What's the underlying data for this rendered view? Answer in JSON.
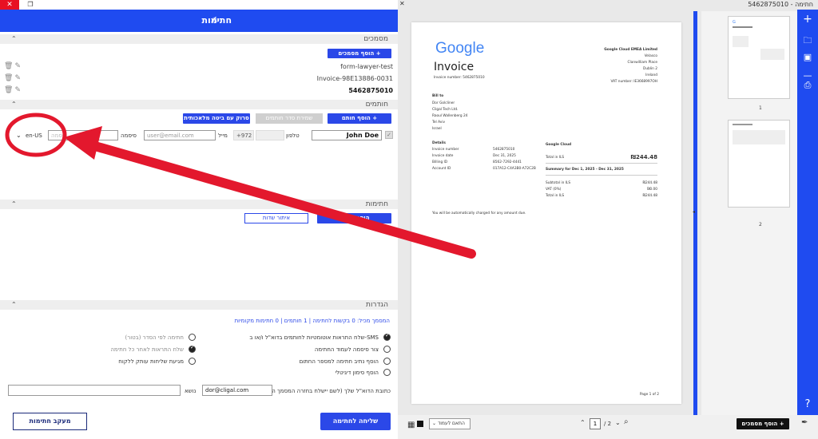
{
  "left_panel": {
    "window_close": "✕",
    "window_restore": "❐",
    "header_title": "חתימות",
    "docs_section": "מסמכים",
    "add_docs_btn": "הוסף מסמכים +",
    "documents": [
      "form-lawyer-test",
      "Invoice-98E13886-0031",
      "5462875010"
    ],
    "signers_section": "חותמים",
    "add_signer_btn": "הוסף חותם +",
    "signer_order_btn": "שמירת סדר חותמים",
    "send_sign_btn": "סרוק עם ביטה מלאכותית",
    "signer_name": "John Doe",
    "phone_label": "טלפון",
    "phone_code": "+972",
    "email_label": "מייל",
    "email_placeholder": "user@email.com",
    "password_label": "סיסמה",
    "password_placeholder": "סיסמה",
    "lang_value": "en-US",
    "signatures_section": "חתימות",
    "add_signature_btn": "הוספת שדה",
    "locate_fields_btn": "איתור שדות",
    "settings_section": "הגדרות",
    "summary_text": "המסמך מכיל: 0 בקשות לחתימה | 1 חותמים | 0 חתימות מקומיות",
    "options_right": [
      "שלח התראות אוטומטיות לחותמים בדוא\"ל ו/או ב-SMS",
      "צור סיסמה לעמוד החתימה",
      "הוסף נתיב חתימה למספר החתום",
      "הוסף סימון דיגיטלי"
    ],
    "options_left": [
      "חתימה לפי הסדר (בטור)",
      "שלח התראות לאחר כל חתימה",
      "מגיעת שליחות עותק ללקוח"
    ],
    "email_field_label": "כתובת הדוא\"ל שלך (לשם יישלח בחזרה המסמך החתום)",
    "email_value": "dor@cligal.com",
    "subject_label": "נושא",
    "send_for_sign_btn": "שליחה לחתימה",
    "track_sign_btn": "מעקב חתימות"
  },
  "right_panel": {
    "title": "5462875010 - חתימה",
    "invoice": {
      "logo": "Google",
      "title": "Invoice",
      "invoice_number_line": "Invoice number: 5462875010",
      "company": [
        "Google Cloud EMEA Limited",
        "Velasco",
        "Clanwilliam Place",
        "Dublin 2",
        "Ireland",
        "VAT number: IE3668997OH"
      ],
      "bill_to_label": "Bill to",
      "bill_to": [
        "Dor Golcliner",
        "Cligal Tech Ltd.",
        "Raoul Wallenberg 24",
        "Tel Aviv",
        "Israel"
      ],
      "details_label": "Details",
      "details": [
        {
          "k": "Invoice number",
          "v": "5462875010"
        },
        {
          "k": "Invoice date",
          "v": "Dec 31, 2025"
        },
        {
          "k": "Billing ID",
          "v": "8562-7292-4441"
        },
        {
          "k": "Account ID",
          "v": "017A12-C4A3B0-A72C2B"
        }
      ],
      "gc_label": "Google Cloud",
      "total_label": "Total in ILS",
      "total_value": "₪244.48",
      "summary_label": "Summary for Dec 1, 2025 - Dec 31, 2025",
      "summary": [
        {
          "k": "Subtotal in ILS",
          "v": "₪244.48"
        },
        {
          "k": "VAT (0%)",
          "v": "₪0.00"
        },
        {
          "k": "Total in ILS",
          "v": "₪244.48"
        }
      ],
      "auto_charge": "You will be automatically charged for any amount due.",
      "page_footer": "Page 1 of 2"
    },
    "thumb_labels": [
      "1",
      "2"
    ],
    "fit_label": "התאם לעמוד",
    "page_current": "1",
    "page_total": "/ 2",
    "add_docs_btn": "הוסף מסמכים +"
  }
}
